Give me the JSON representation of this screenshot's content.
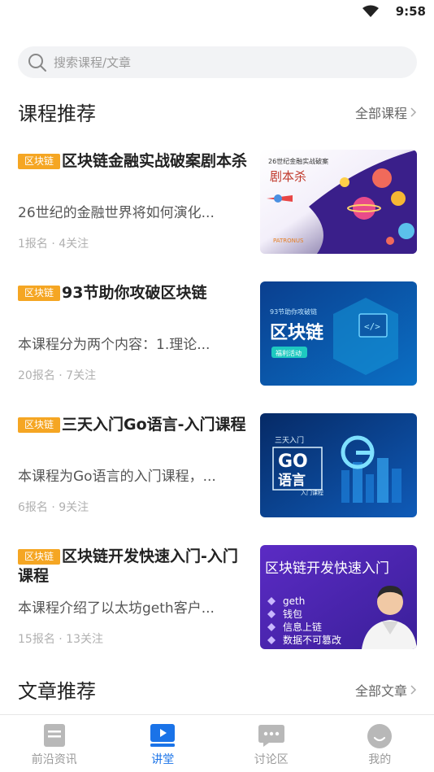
{
  "status": {
    "time": "9:58"
  },
  "search": {
    "placeholder": "搜索课程/文章"
  },
  "courses_section": {
    "title": "课程推荐",
    "more": "全部课程"
  },
  "courses": [
    {
      "tag": "区块链",
      "title": "区块链金融实战破案剧本杀",
      "desc": "26世纪的金融世界将如何演化...",
      "meta": "1报名 · 4关注",
      "thumb": {
        "line1": "26世纪金融实战破案",
        "line2": "剧本杀",
        "brand": "PATRONUS"
      }
    },
    {
      "tag": "区块链",
      "title": "93节助你攻破区块链",
      "desc": "本课程分为两个内容：1.理论...",
      "meta": "20报名 · 7关注",
      "thumb": {
        "line1": "93节助你攻破链",
        "line2": "区块链",
        "badge": "福利活动"
      }
    },
    {
      "tag": "区块链",
      "title": "三天入门Go语言-入门课程",
      "desc": "本课程为Go语言的入门课程，...",
      "meta": "6报名 · 9关注",
      "thumb": {
        "line1": "三天入门",
        "line2": "GO",
        "line3": "语言",
        "line4": "入门课程"
      }
    },
    {
      "tag": "区块链",
      "title": "区块链开发快速入门-入门课程",
      "desc": "本课程介绍了以太坊geth客户...",
      "meta": "15报名 · 13关注",
      "thumb": {
        "line1": "区块链开发快速入门",
        "bullets": [
          "geth",
          "钱包",
          "信息上链",
          "数据不可篡改"
        ]
      }
    }
  ],
  "articles_section": {
    "title": "文章推荐",
    "more": "全部文章"
  },
  "tabs": [
    {
      "label": "前沿资讯",
      "icon": "news-icon",
      "active": false
    },
    {
      "label": "讲堂",
      "icon": "lecture-icon",
      "active": true
    },
    {
      "label": "讨论区",
      "icon": "chat-icon",
      "active": false
    },
    {
      "label": "我的",
      "icon": "profile-icon",
      "active": false
    }
  ],
  "colors": {
    "accent": "#1a73e8",
    "tag": "#f5a623"
  }
}
